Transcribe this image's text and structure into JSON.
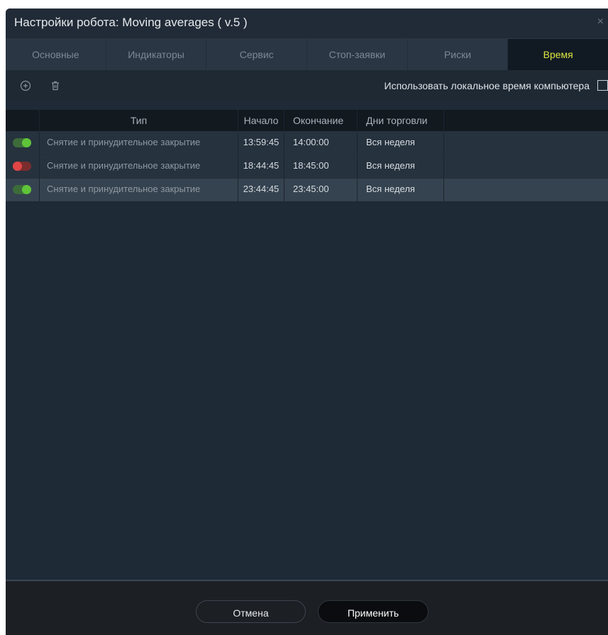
{
  "window": {
    "title": "Настройки робота: Moving averages ( v.5 )",
    "close_glyph": "×"
  },
  "tabs": [
    {
      "label": "Основные",
      "active": false
    },
    {
      "label": "Индикаторы",
      "active": false
    },
    {
      "label": "Сервис",
      "active": false
    },
    {
      "label": "Стоп-заявки",
      "active": false
    },
    {
      "label": "Риски",
      "active": false
    },
    {
      "label": "Время",
      "active": true
    }
  ],
  "toolbar": {
    "add_icon": "plus-circle-icon",
    "delete_icon": "trash-icon",
    "local_time_label": "Использовать локальное время компьютера",
    "local_time_checked": false
  },
  "table": {
    "columns": [
      "",
      "Тип",
      "Начало",
      "Окончание",
      "Дни торговли"
    ],
    "rows": [
      {
        "enabled": true,
        "type": "Снятие и принудительное закрытие",
        "start": "13:59:45",
        "end": "14:00:00",
        "days": "Вся неделя",
        "selected": false
      },
      {
        "enabled": false,
        "type": "Снятие и принудительное закрытие",
        "start": "18:44:45",
        "end": "18:45:00",
        "days": "Вся неделя",
        "selected": false
      },
      {
        "enabled": true,
        "type": "Снятие и принудительное закрытие",
        "start": "23:44:45",
        "end": "23:45:00",
        "days": "Вся неделя",
        "selected": true
      }
    ]
  },
  "footer": {
    "cancel_label": "Отмена",
    "apply_label": "Применить"
  },
  "colors": {
    "active_tab_text": "#dde541",
    "toggle_on": "#5fc43a",
    "toggle_off": "#e04646"
  }
}
